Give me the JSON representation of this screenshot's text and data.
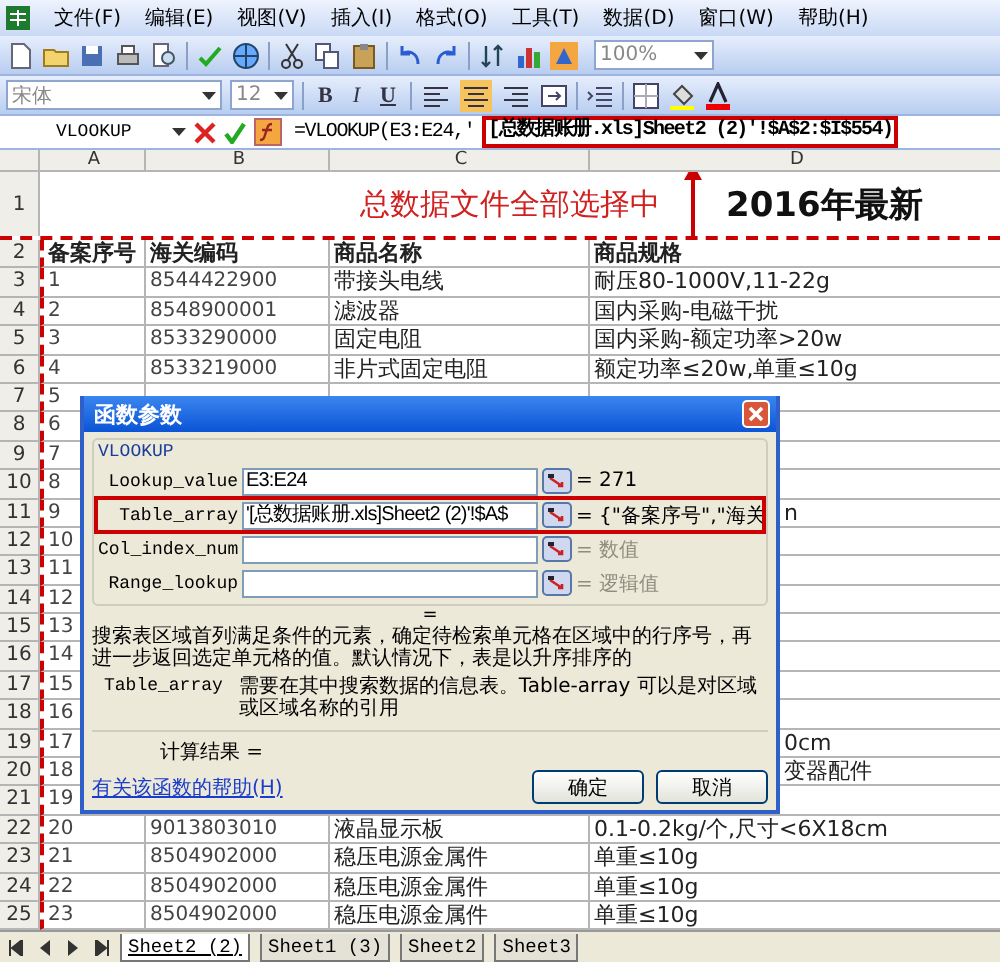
{
  "menu": [
    "文件(F)",
    "编辑(E)",
    "视图(V)",
    "插入(I)",
    "格式(O)",
    "工具(T)",
    "数据(D)",
    "窗口(W)",
    "帮助(H)"
  ],
  "toolbar_standard": {
    "zoom": "100%"
  },
  "toolbar_format": {
    "font": "宋体",
    "size": "12",
    "styles": [
      "B",
      "I",
      "U"
    ],
    "alignment": [
      {
        "selected": false
      },
      {
        "selected": true
      },
      {
        "selected": false
      }
    ]
  },
  "formula_bar": {
    "name_box": "VLOOKUP",
    "formula": "=VLOOKUP(E3:E24,'",
    "formula_highlighted": "[总数据账册.xls]Sheet2 (2)'!$A$2:$I$554)"
  },
  "columns": [
    "A",
    "B",
    "C",
    "D"
  ],
  "title_row": {
    "number": "1",
    "annotation": "总数据文件全部选择中",
    "heading": "2016年最新"
  },
  "rows": [
    {
      "number": "2",
      "kind": "header",
      "cells": [
        "备案序号",
        "海关编码",
        "商品名称",
        "商品规格"
      ]
    },
    {
      "number": "3",
      "kind": "data",
      "cells": [
        "1",
        "8544422900",
        "带接头电线",
        "耐压80-1000V,11-22g"
      ]
    },
    {
      "number": "4",
      "kind": "data",
      "cells": [
        "2",
        "8548900001",
        "滤波器",
        "国内采购-电磁干扰"
      ]
    },
    {
      "number": "5",
      "kind": "data",
      "cells": [
        "3",
        "8533290000",
        "固定电阻",
        "国内采购-额定功率>20w"
      ]
    },
    {
      "number": "6",
      "kind": "data",
      "cells": [
        "4",
        "8533219000",
        "非片式固定电阻",
        "额定功率≤20w,单重≤10g"
      ]
    },
    {
      "number": "7",
      "kind": "covered",
      "cells": [
        "5"
      ]
    },
    {
      "number": "8",
      "kind": "covered",
      "cells": [
        "6"
      ]
    },
    {
      "number": "9",
      "kind": "covered",
      "cells": [
        "7"
      ]
    },
    {
      "number": "10",
      "kind": "covered",
      "cells": [
        "8"
      ]
    },
    {
      "number": "11",
      "kind": "covered",
      "cells": [
        "9"
      ],
      "tail": "n"
    },
    {
      "number": "12",
      "kind": "covered",
      "cells": [
        "10"
      ]
    },
    {
      "number": "13",
      "kind": "covered",
      "cells": [
        "11"
      ]
    },
    {
      "number": "14",
      "kind": "covered",
      "cells": [
        "12"
      ]
    },
    {
      "number": "15",
      "kind": "covered",
      "cells": [
        "13"
      ]
    },
    {
      "number": "16",
      "kind": "covered",
      "cells": [
        "14"
      ]
    },
    {
      "number": "17",
      "kind": "covered",
      "cells": [
        "15"
      ]
    },
    {
      "number": "18",
      "kind": "covered",
      "cells": [
        "16"
      ]
    },
    {
      "number": "19",
      "kind": "covered",
      "cells": [
        "17"
      ],
      "tail": "0cm"
    },
    {
      "number": "20",
      "kind": "covered",
      "cells": [
        "18"
      ],
      "tail": "变器配件"
    },
    {
      "number": "21",
      "kind": "covered",
      "cells": [
        "19"
      ]
    },
    {
      "number": "22",
      "kind": "data",
      "cells": [
        "20",
        "9013803010",
        "液晶显示板",
        "0.1-0.2kg/个,尺寸<6X18cm"
      ]
    },
    {
      "number": "23",
      "kind": "data",
      "cells": [
        "21",
        "8504902000",
        "稳压电源金属件",
        "单重≤10g"
      ]
    },
    {
      "number": "24",
      "kind": "data",
      "cells": [
        "22",
        "8504902000",
        "稳压电源金属件",
        "单重≤10g"
      ]
    },
    {
      "number": "25",
      "kind": "data",
      "cells": [
        "23",
        "8504902000",
        "稳压电源金属件",
        "单重≤10g"
      ]
    }
  ],
  "dialog": {
    "title": "函数参数",
    "function": "VLOOKUP",
    "params": [
      {
        "name": "Lookup_value",
        "value": "E3:E24",
        "result": "= 271",
        "highlighted": false
      },
      {
        "name": "Table_array",
        "value": "'[总数据账册.xls]Sheet2 (2)'!$A$",
        "result": "= {\"备案序号\",\"海关",
        "highlighted": true
      },
      {
        "name": "Col_index_num",
        "result": "= 数值",
        "highlighted": false
      },
      {
        "name": "Range_lookup",
        "result": "= 逻辑值",
        "highlighted": false
      }
    ],
    "result_line": "=",
    "description": "搜索表区域首列满足条件的元素，确定待检索单元格在区域中的行序号，再进一步返回选定单元格的值。默认情况下，表是以升序排序的",
    "arg_name": "Table_array",
    "arg_description": "需要在其中搜索数据的信息表。Table-array 可以是对区域或区域名称的引用",
    "result_label": "计算结果 =",
    "help_link": "有关该函数的帮助(H)",
    "buttons": [
      "确定",
      "取消"
    ]
  },
  "sheet_tabs": [
    {
      "label": "Sheet2 (2)",
      "selected": true
    },
    {
      "label": "Sheet1 (3)",
      "selected": false
    },
    {
      "label": "Sheet2",
      "selected": false
    },
    {
      "label": "Sheet3",
      "selected": false
    }
  ]
}
